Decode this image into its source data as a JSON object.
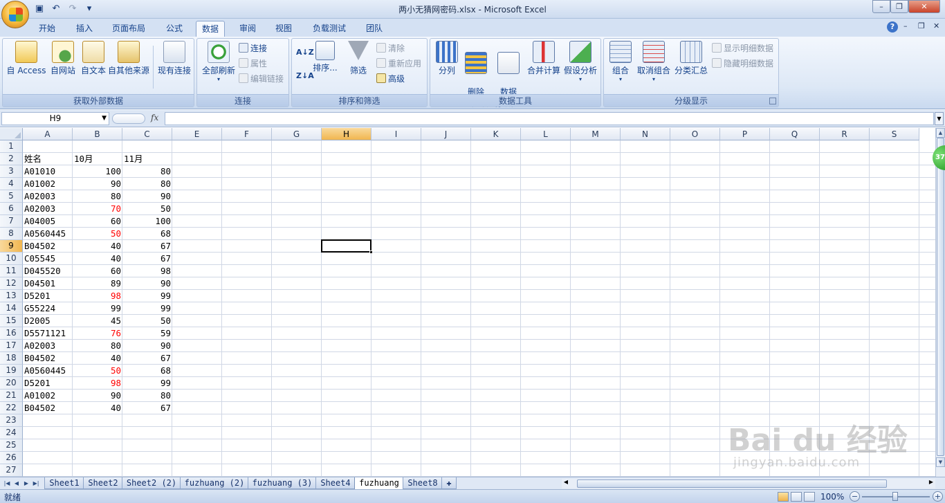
{
  "window": {
    "title": "两小无猜网密码.xlsx - Microsoft Excel",
    "min": "–",
    "max": "❐",
    "close": "✕"
  },
  "ribbon_tabs": [
    "开始",
    "插入",
    "页面布局",
    "公式",
    "数据",
    "审阅",
    "视图",
    "负载测试",
    "团队"
  ],
  "active_tab": "数据",
  "groups": {
    "external": {
      "label": "获取外部数据",
      "buttons": [
        "自 Access",
        "自网站",
        "自文本",
        "自其他来源",
        "现有连接"
      ]
    },
    "connections": {
      "label": "连接",
      "refresh": "全部刷新",
      "small": [
        "连接",
        "属性",
        "编辑链接"
      ]
    },
    "sort": {
      "label": "排序和筛选",
      "sort": "排序...",
      "filter": "筛选",
      "small": [
        "清除",
        "重新应用",
        "高级"
      ]
    },
    "tools": {
      "label": "数据工具",
      "buttons": [
        "分列",
        "删除\n重复项",
        "数据\n有效性",
        "合并计算",
        "假设分析"
      ]
    },
    "outline": {
      "label": "分级显示",
      "buttons": [
        "组合",
        "取消组合",
        "分类汇总"
      ],
      "small": [
        "显示明细数据",
        "隐藏明细数据"
      ]
    }
  },
  "formula_bar": {
    "name_box": "H9",
    "fx": "fx",
    "value": ""
  },
  "columns": [
    "A",
    "B",
    "C",
    "E",
    "F",
    "G",
    "H",
    "I",
    "J",
    "K",
    "L",
    "M",
    "N",
    "O",
    "P",
    "Q",
    "R",
    "S"
  ],
  "selected_column": "H",
  "selected_row": 9,
  "rows": [
    [
      "",
      "",
      ""
    ],
    [
      "姓名",
      "10月",
      "11月"
    ],
    [
      "A01010",
      "100",
      "80"
    ],
    [
      "A01002",
      "90",
      "80"
    ],
    [
      "A02003",
      "80",
      "90"
    ],
    [
      "A02003",
      "70",
      "50"
    ],
    [
      "A04005",
      "60",
      "100"
    ],
    [
      "A0560445",
      "50",
      "68"
    ],
    [
      "B04502",
      "40",
      "67"
    ],
    [
      "C05545",
      "40",
      "67"
    ],
    [
      "D045520",
      "60",
      "98"
    ],
    [
      "D04501",
      "89",
      "90"
    ],
    [
      "D5201",
      "98",
      "99"
    ],
    [
      "G55224",
      "99",
      "99"
    ],
    [
      "D2005",
      "45",
      "50"
    ],
    [
      "D5571121",
      "76",
      "59"
    ],
    [
      "A02003",
      "80",
      "90"
    ],
    [
      "B04502",
      "40",
      "67"
    ],
    [
      "A0560445",
      "50",
      "68"
    ],
    [
      "D5201",
      "98",
      "99"
    ],
    [
      "A01002",
      "90",
      "80"
    ],
    [
      "B04502",
      "40",
      "67"
    ],
    [
      "",
      "",
      ""
    ],
    [
      "",
      "",
      ""
    ],
    [
      "",
      "",
      ""
    ],
    [
      "",
      "",
      ""
    ],
    [
      "",
      "",
      ""
    ]
  ],
  "red_rows_col_b": [
    6,
    8,
    13,
    16,
    19,
    20
  ],
  "sheet_tabs": [
    "Sheet1",
    "Sheet2",
    "Sheet2 (2)",
    "fuzhuang (2)",
    "fuzhuang (3)",
    "Sheet4",
    "fuzhuang",
    "Sheet8"
  ],
  "active_sheet": "fuzhuang",
  "status": {
    "ready": "就绪",
    "zoom": "100%"
  },
  "badge": "37",
  "watermark": {
    "brand": "Bai du 经验",
    "url": "jingyan.baidu.com"
  }
}
